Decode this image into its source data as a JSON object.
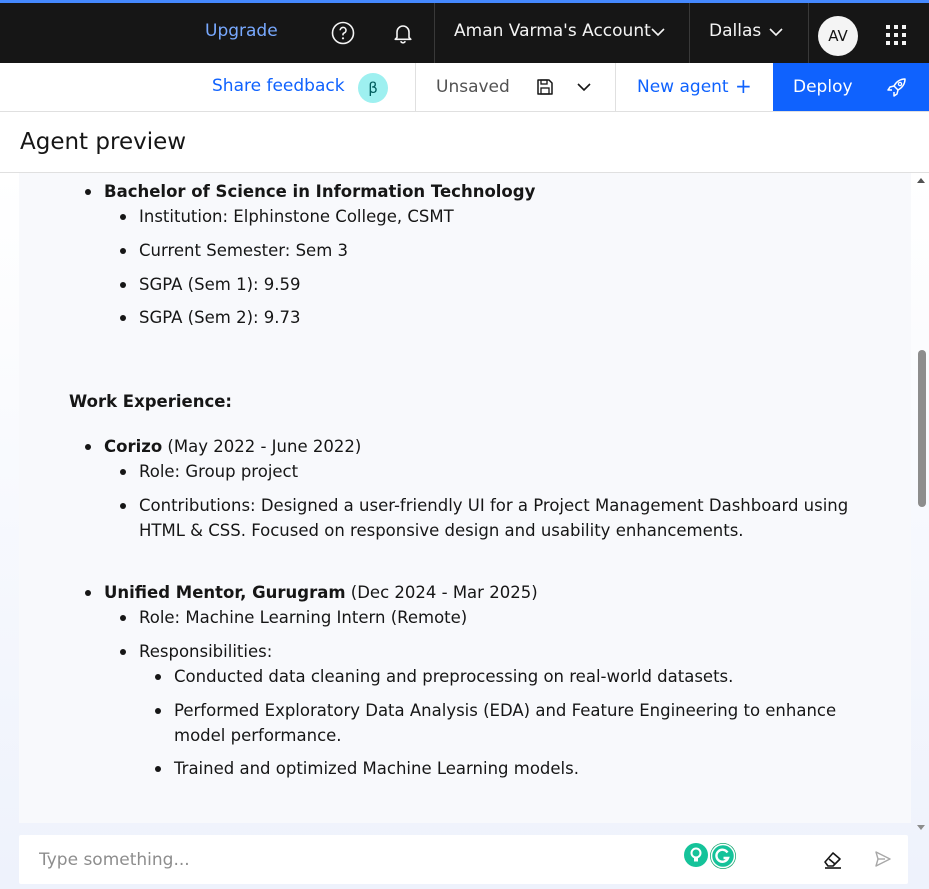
{
  "topbar": {
    "upgrade_label": "Upgrade",
    "account_label": "Aman Varma's Account",
    "region_label": "Dallas",
    "avatar_initials": "AV",
    "help_icon": "help-circle-icon",
    "notification_icon": "bell-icon",
    "apps_icon": "app-switcher-icon"
  },
  "toolbar": {
    "share_feedback_label": "Share feedback",
    "beta_badge": "β",
    "save_status": "Unsaved",
    "new_agent_label": "New agent",
    "new_agent_icon": "+",
    "deploy_label": "Deploy"
  },
  "preview": {
    "title": "Agent preview"
  },
  "message": {
    "education": {
      "degree": "Bachelor of Science in Information Technology",
      "items": [
        "Institution: Elphinstone College, CSMT",
        "Current Semester: Sem 3",
        "SGPA (Sem 1): 9.59",
        "SGPA (Sem 2): 9.73"
      ]
    },
    "work_heading": "Work Experience:",
    "jobs": [
      {
        "company": "Corizo",
        "period": " (May 2022 - June 2022)",
        "role": "Role: Group project",
        "contributions_line1": "Contributions: Designed a user-friendly UI for a Project Management Dashboard using",
        "contributions_line2": "HTML & CSS. Focused on responsive design and usability enhancements."
      },
      {
        "company": "Unified Mentor, Gurugram",
        "period": " (Dec 2024 - Mar 2025)",
        "role": "Role: Machine Learning Intern (Remote)",
        "responsibilities_label": "Responsibilities:",
        "responsibilities": [
          "Conducted data cleaning and preprocessing on real-world datasets.",
          "Performed Exploratory Data Analysis (EDA) and Feature Engineering to enhance",
          "model performance.",
          "Trained and optimized Machine Learning models."
        ]
      }
    ]
  },
  "input": {
    "placeholder": "Type something..."
  },
  "colors": {
    "topbar_bg": "#161616",
    "accent_blue": "#0f62fe",
    "link_blue_dark": "#78a9ff",
    "beta_bg": "#9ef0f0",
    "grammarly_green": "#15c39a"
  }
}
